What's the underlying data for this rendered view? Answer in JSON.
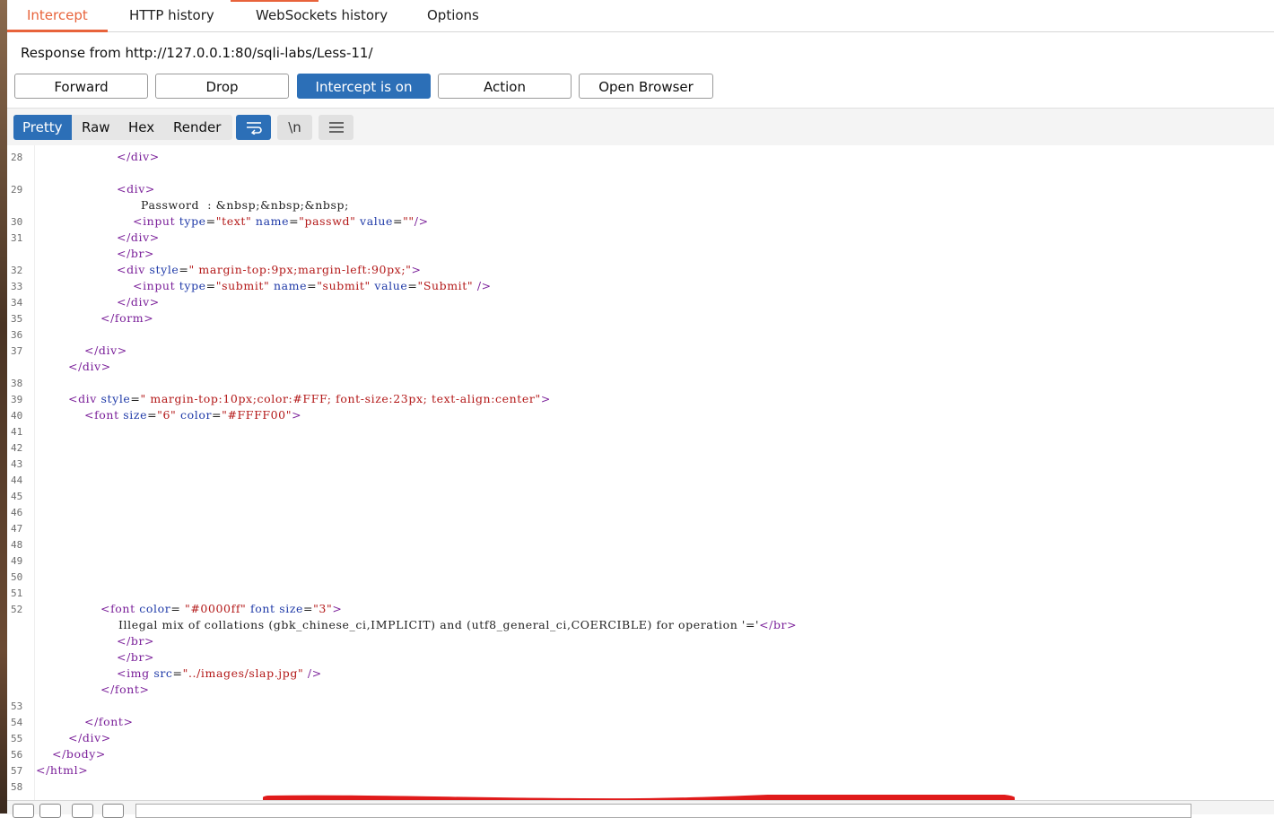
{
  "tabs": [
    {
      "label": "Intercept",
      "active": true
    },
    {
      "label": "HTTP history",
      "active": false
    },
    {
      "label": "WebSockets history",
      "active": false
    },
    {
      "label": "Options",
      "active": false
    }
  ],
  "response_line": "Response from http://127.0.0.1:80/sqli-labs/Less-11/",
  "buttons": {
    "forward": "Forward",
    "drop": "Drop",
    "intercept": "Intercept is on",
    "action": "Action",
    "open_browser": "Open Browser"
  },
  "view_tabs": [
    "Pretty",
    "Raw",
    "Hex",
    "Render"
  ],
  "icons": {
    "wrap": "wrap-lines-icon",
    "newline": "\\n",
    "menu": "menu-icon"
  },
  "line_numbers": [
    "28",
    "29",
    "30",
    "31",
    "32",
    "33",
    "34",
    "35",
    "36",
    "37",
    "38",
    "39",
    "40",
    "41",
    "42",
    "43",
    "44",
    "45",
    "46",
    "47",
    "48",
    "49",
    "50",
    "51",
    "52",
    "53",
    "54",
    "55",
    "56",
    "57",
    "58"
  ],
  "code": {
    "l28": "</div>",
    "l29_open": "<div>",
    "l29_text": "Password  : &nbsp;&nbsp;&nbsp;",
    "l30_input": "<input",
    "l30_type": "type",
    "l30_type_val": "\"text\"",
    "l30_name": "name",
    "l30_name_val": "\"passwd\"",
    "l30_value": "value",
    "l30_value_val": "\"\"",
    "l30_close": "/>",
    "l31": "</div>",
    "l31b": "</br>",
    "l32_open": "<div",
    "l32_style": "style",
    "l32_style_val": "\" margin-top:9px;margin-left:90px;\"",
    "l32_close": ">",
    "l33_input": "<input",
    "l33_type": "type",
    "l33_type_val": "\"submit\"",
    "l33_name": "name",
    "l33_name_val": "\"submit\"",
    "l33_value": "value",
    "l33_value_val": "\"Submit\"",
    "l33_close": "/>",
    "l34": "</div>",
    "l35": "</form>",
    "l37": "</div>",
    "l37b": "</div>",
    "l39_open": "<div",
    "l39_style": "style",
    "l39_style_val": "\" margin-top:10px;color:#FFF; font-size:23px; text-align:center\"",
    "l39_close": ">",
    "l40_font": "<font",
    "l40_size": "size",
    "l40_size_val": "\"6\"",
    "l40_color": "color",
    "l40_color_val": "\"#FFFF00\"",
    "l40_close": ">",
    "l52_font": "<font",
    "l52_color": "color",
    "l52_color_val": "\"#0000ff\"",
    "l52_fontattr": "font",
    "l52_size": "size",
    "l52_size_val": "\"3\"",
    "l52_close": ">",
    "l52_error": "Illegal mix of collations (gbk_chinese_ci,IMPLICIT) and (utf8_general_ci,COERCIBLE) for operation '='",
    "l52_error_br": "</br>",
    "l52_br1": "</br>",
    "l52_br2": "</br>",
    "l52_img": "<img",
    "l52_src": "src",
    "l52_src_val": "\"../images/slap.jpg\"",
    "l52_img_close": "/>",
    "l52_font_close": "</font>",
    "l54": "</font>",
    "l55": "</div>",
    "l56": "</body>",
    "l57": "</html>"
  },
  "colors": {
    "accent": "#e8633b",
    "primary": "#2c6fb7",
    "tag": "#7a1f99",
    "attr": "#1f3aa8",
    "value": "#b31818",
    "redaction": "#e01b1b"
  }
}
